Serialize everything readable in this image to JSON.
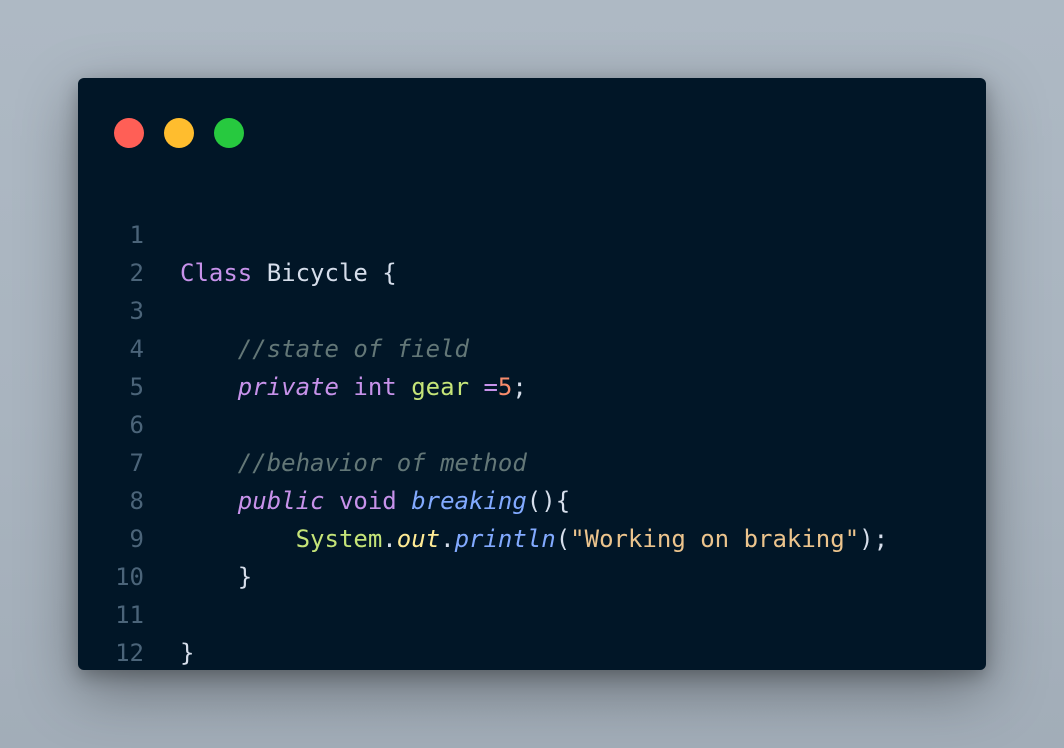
{
  "window": {
    "controls": [
      {
        "name": "close",
        "color": "#ff5f56"
      },
      {
        "name": "minimize",
        "color": "#ffbd2e"
      },
      {
        "name": "maximize",
        "color": "#27c93f"
      }
    ]
  },
  "code": {
    "line_numbers": [
      "1",
      "2",
      "3",
      "4",
      "5",
      "6",
      "7",
      "8",
      "9",
      "10",
      "11",
      "12"
    ],
    "line1": {
      "kw": "Class",
      "name": " Bicycle {"
    },
    "line3": {
      "indent": "    ",
      "comment": "//state of field"
    },
    "line4": {
      "indent": "    ",
      "kw": "private",
      "sp1": " ",
      "type": "int",
      "sp2": " ",
      "ident": "gear",
      "sp3": " ",
      "op": "=",
      "num": "5",
      "end": ";"
    },
    "line6": {
      "indent": "    ",
      "comment": "//behavior of method"
    },
    "line7": {
      "indent": "    ",
      "kw": "public",
      "sp1": " ",
      "type": "void",
      "sp2": " ",
      "fn": "breaking",
      "rest": "(){"
    },
    "line8": {
      "indent": "        ",
      "sys": "System",
      "dot1": ".",
      "out": "out",
      "dot2": ".",
      "fn": "println",
      "open": "(",
      "str": "\"Working on braking\"",
      "close": ");"
    },
    "line9": {
      "indent": "    ",
      "text": "}"
    },
    "line11": {
      "text": "}"
    }
  }
}
